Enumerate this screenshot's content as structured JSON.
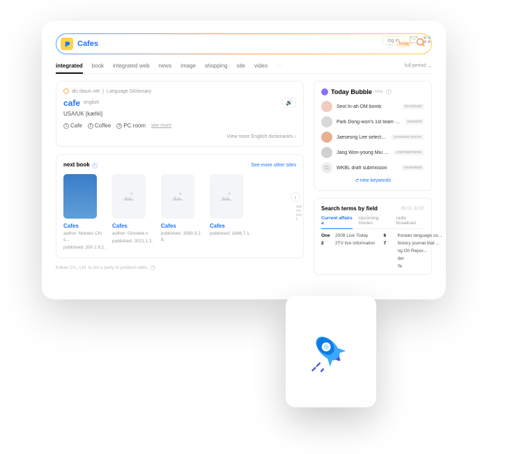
{
  "search_query": "Cafes",
  "search_badge": "beta",
  "topright": {
    "login": "log in"
  },
  "tabs": [
    "integrated",
    "book",
    "integrated web",
    "news",
    "image",
    "shopping",
    "site",
    "video"
  ],
  "period": "full period",
  "dict": {
    "source": "dic.daum.net",
    "source_label": "Language Dictionary",
    "word": "cafe",
    "lang": "english",
    "phonetic": "USA/UK [kæféi]",
    "defs": [
      "Cafe",
      "Coffee",
      "PC room"
    ],
    "seemore": "see more",
    "viewmore": "View more English dictionaries"
  },
  "books": {
    "title": "next book",
    "seelinks": "See more other sites",
    "chevron_text": "appear book",
    "items": [
      {
        "title": "Cafes",
        "author": "author: Montes Chis...",
        "pub": "published: 200 2.9.1."
      },
      {
        "title": "Cafes",
        "author": "author: Ginneke n",
        "pub": "published: 2021.1.1."
      },
      {
        "title": "Cafes",
        "author": "",
        "pub": "published: 1999.3.28."
      },
      {
        "title": "Cafes",
        "author": "",
        "pub": "published: 1988.7.1."
      }
    ]
  },
  "footer": "Kakao Co., Ltd. is not a party to product sales.",
  "bubble": {
    "title": "Today Bubble",
    "beta": "beta",
    "items": [
      {
        "text": "Seol In-ah DM bomb",
        "tag": "broadcast",
        "avatar": "#f0ccc0"
      },
      {
        "text": "Park Dong-won's 1st team expun...",
        "tag": "baseball",
        "avatar": "#d8d8d8"
      },
      {
        "text": "Jaeseong Lee selected",
        "tag": "overseas soccer",
        "avatar": "#e8b090"
      },
      {
        "text": "Jang Won-young Miu Miu p...",
        "tag": "entertainments",
        "avatar": "#d0d0d0"
      },
      {
        "text": "WKBL draft submission",
        "tag": "basketball",
        "avatar": "#eee"
      }
    ],
    "refresh": "new keywords"
  },
  "sterms": {
    "title": "Search terms by field",
    "time": "05.13. 21:57",
    "tabs": [
      "Current affairs a",
      "Upcoming movies",
      "radio broadcast"
    ],
    "left": [
      {
        "rank": "One",
        "txt": "2008 Live Today"
      },
      {
        "rank": "2",
        "txt": "2TV live information"
      }
    ],
    "right": [
      {
        "rank": "6",
        "txt": "Korean language co..."
      },
      {
        "rank": "7",
        "txt": "history journal that ..."
      },
      {
        "rank": "",
        "txt": "ng Oh Repor..."
      },
      {
        "rank": "",
        "txt": "der"
      },
      {
        "rank": "",
        "txt": "'fe"
      }
    ]
  }
}
